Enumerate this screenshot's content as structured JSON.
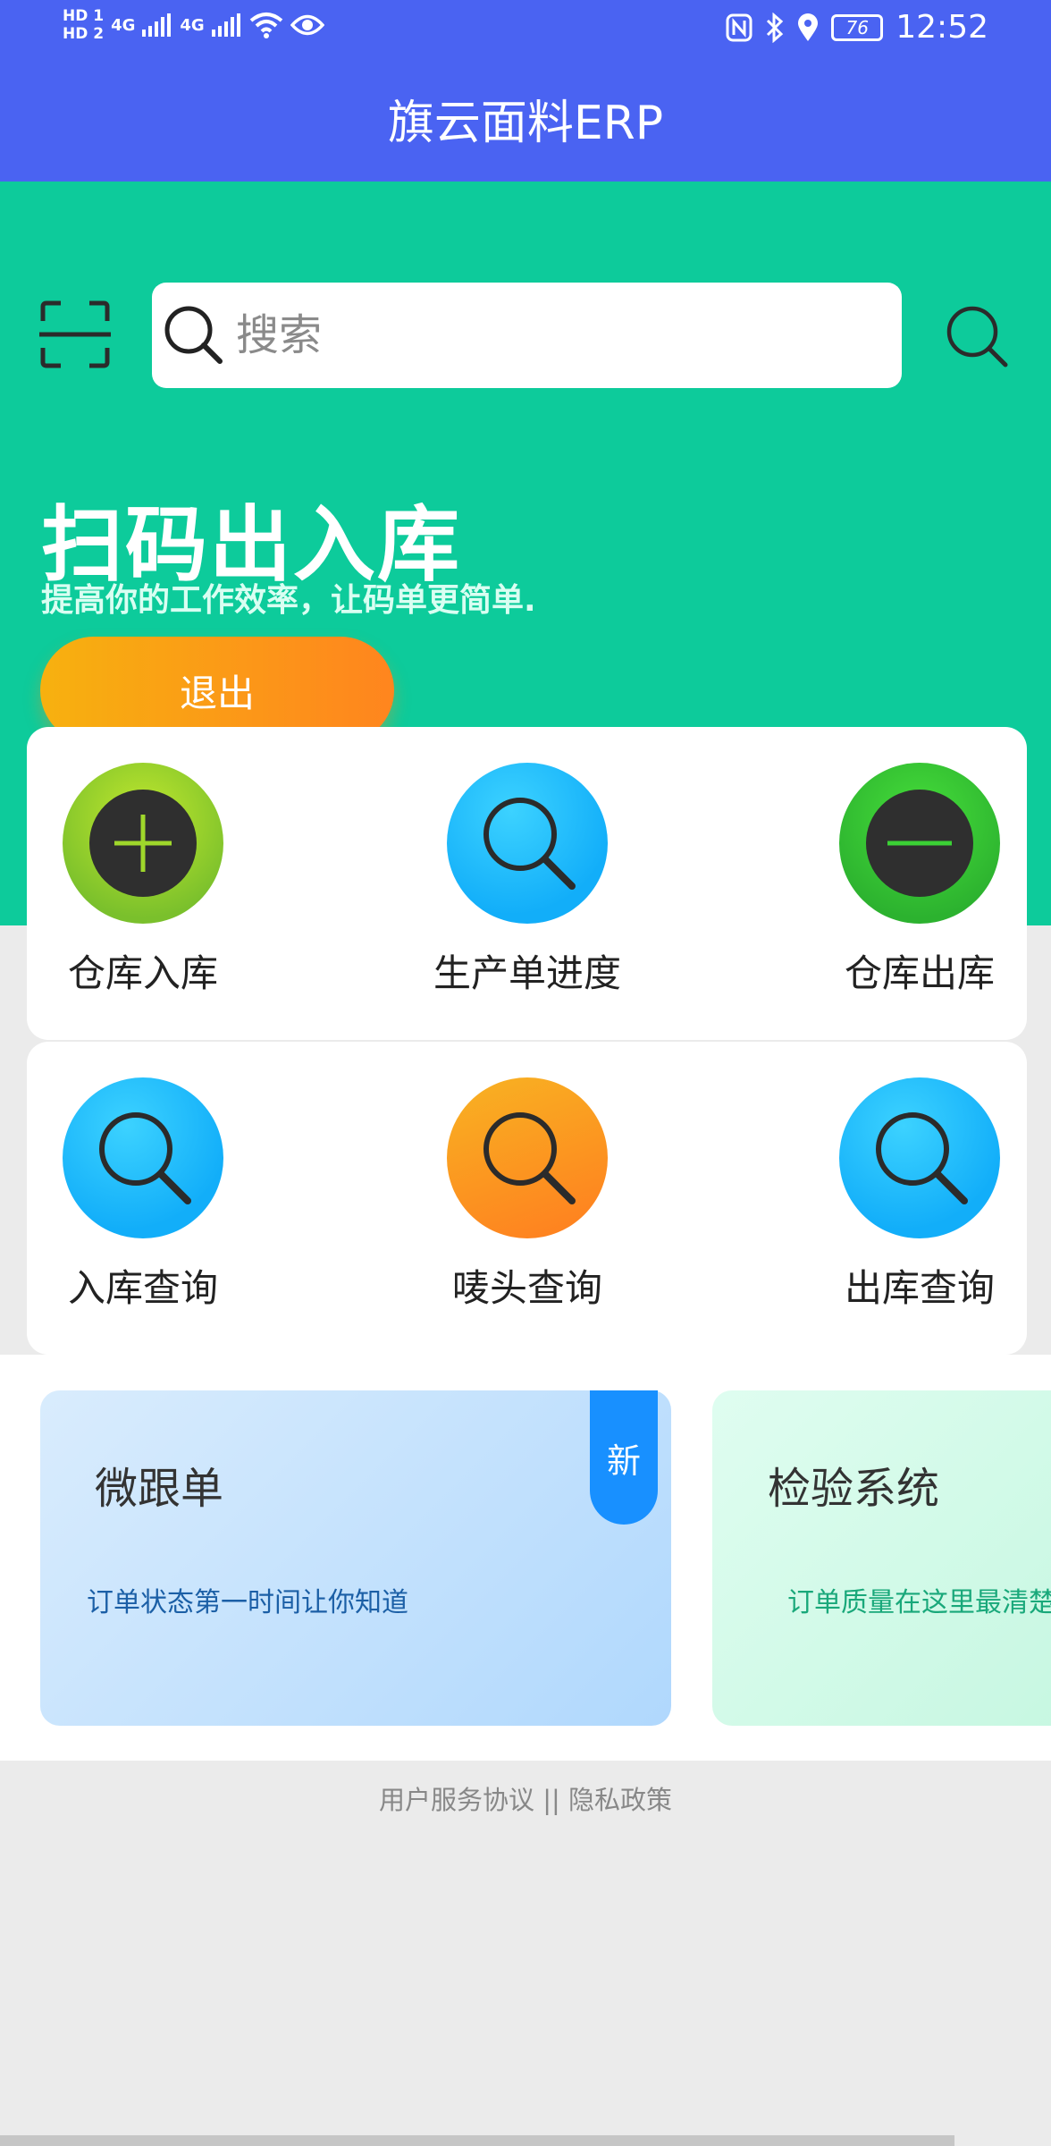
{
  "status_bar": {
    "sim1": "HD 1",
    "sim2": "HD 2",
    "net1": "4G",
    "net2": "4G",
    "battery": "76",
    "time": "12:52"
  },
  "app": {
    "title": "旗云面料ERP"
  },
  "search": {
    "placeholder": "搜索"
  },
  "hero": {
    "title": "扫码出入库",
    "subtitle": "提高你的工作效率，让码单更简单.",
    "exit_label": "退出"
  },
  "functions_row1": [
    {
      "label": "仓库入库",
      "icon": "plus-icon",
      "color": "lime"
    },
    {
      "label": "生产单进度",
      "icon": "search-icon",
      "color": "blue"
    },
    {
      "label": "仓库出库",
      "icon": "minus-icon",
      "color": "green"
    }
  ],
  "functions_row2": [
    {
      "label": "入库查询",
      "icon": "search-icon",
      "color": "blue"
    },
    {
      "label": "唛头查询",
      "icon": "search-icon",
      "color": "orange"
    },
    {
      "label": "出库查询",
      "icon": "search-icon",
      "color": "blue"
    }
  ],
  "promos": [
    {
      "title": "微跟单",
      "desc": "订单状态第一时间让你知道",
      "badge": "新"
    },
    {
      "title": "检验系统",
      "desc": "订单质量在这里最清楚"
    }
  ],
  "footer": {
    "text": "用户服务协议 || 隐私政策"
  },
  "colors": {
    "header": "#4a63f2",
    "hero": "#0dcb9b",
    "exit_gradient": [
      "#f7b10f",
      "#ff851e"
    ],
    "badge": "#1890ff"
  }
}
